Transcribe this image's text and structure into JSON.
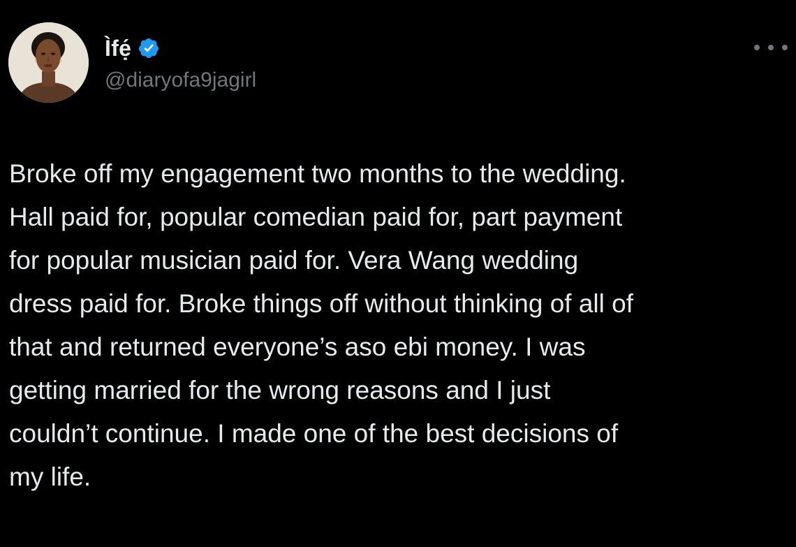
{
  "theme": {
    "background": "#000000",
    "text_primary": "#e7e9ea",
    "text_secondary": "#71767b",
    "verified_badge": "#1d9bf0"
  },
  "tweet": {
    "author": {
      "display_name": "Ìfẹ́",
      "handle": "@diaryofa9jagirl",
      "verified": true,
      "avatar_icon": "profile-photo",
      "verified_icon": "verified-badge-icon"
    },
    "more_icon": "more-options-icon",
    "text_lines": [
      "Broke off my engagement two months to the wedding.",
      "Hall paid for, popular comedian paid for, part payment",
      "for popular musician paid for. Vera Wang wedding",
      "dress paid for. Broke things off without thinking of all of",
      "that and returned everyone’s aso ebi money. I was",
      "getting married for the wrong reasons and I just",
      "couldn’t continue. I made one of the best decisions of",
      "my life."
    ]
  }
}
